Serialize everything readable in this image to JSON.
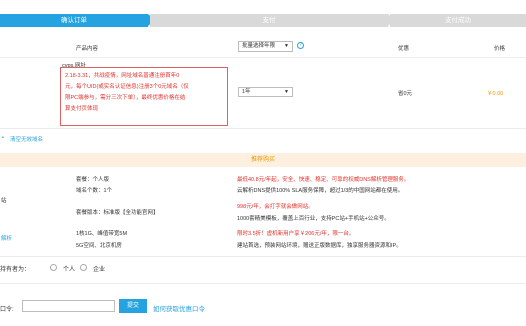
{
  "steps": [
    "确认订单",
    "支付",
    "支付成功"
  ],
  "table_header": {
    "product": "产品内容",
    "batch_select": "批量选择年限",
    "discount": "优惠",
    "price": "价格"
  },
  "order": {
    "product_name": "cvps.网址",
    "notice_lines": [
      "2.18-3.31，共战疫情，网址域名普通注册首年0",
      "元，每个UID(或实名认证信息)注册3个0元域名（仅",
      "限PC端参与，需分三次下单），最终优惠价格在结",
      "算支付页体现"
    ],
    "period": "1年",
    "discount": "省0元",
    "price": "￥0.00"
  },
  "links": {
    "clear": "清空无效域名"
  },
  "recommend": {
    "title": "推荐购买",
    "items": [
      "套餐：个人版",
      "域名个数：1个",
      "最低40.8元/年起，安全、快速、稳定、可靠的权威DNS解析管理服务。",
      "云解析DNS提供100% SLA服务保障，超过1/3的中国网站都在使用。",
      "套餐版本：标准版【全功能官网】",
      "998元/年，会打字就会做网站。",
      "1000套精美模板，覆盖上百行业，支持PC站+手机站+公众号。",
      "1核1G、峰值带宽5M",
      "5G空间、北京机房",
      "限时3.5折！虚机新用户享￥206元/年，限一台。",
      "建站首选，预装网站环境，赠送正版数据库，独享服务器资源和IP。"
    ],
    "side_labels": [
      "解析",
      "站",
      "机"
    ]
  },
  "holder": {
    "label": "持有者为：",
    "options": [
      "个人",
      "企业"
    ]
  },
  "coupon": {
    "label": "口令:",
    "button": "提交",
    "link": "如何获取优惠口令"
  }
}
